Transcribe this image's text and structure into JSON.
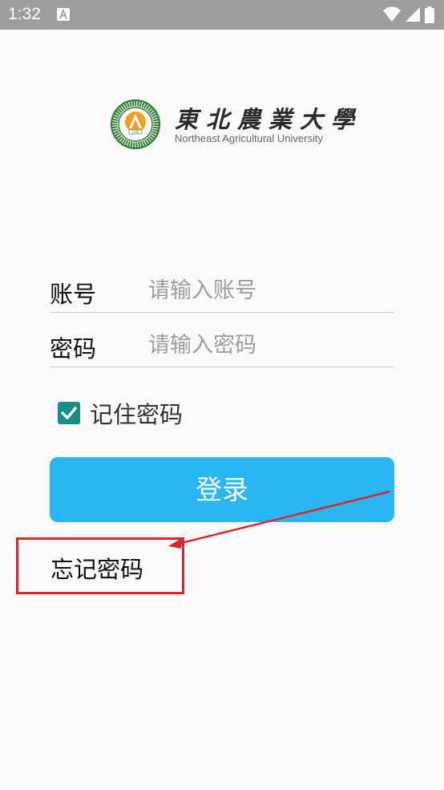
{
  "status_bar": {
    "time": "1:32",
    "notification_icon": "a-notification-icon",
    "icons": [
      "wifi-icon",
      "signal-icon",
      "battery-icon"
    ]
  },
  "logo": {
    "name_cn": "東北農業大學",
    "name_en": "Northeast Agricultural University",
    "seal_text": "NORTHEAST AGRICULTURAL UNIVERSITY",
    "seal_year": "1948",
    "seal_color": "#2e7d32",
    "seal_accent": "#f0a020"
  },
  "form": {
    "account": {
      "label": "账号",
      "placeholder": "请输入账号",
      "value": ""
    },
    "password": {
      "label": "密码",
      "placeholder": "请输入密码",
      "value": ""
    },
    "remember": {
      "label": "记住密码",
      "checked": true,
      "color": "#138f87"
    },
    "login_label": "登录",
    "login_color": "#29b6f2",
    "forgot_label": "忘记密码"
  },
  "annotation": {
    "color": "#d9262f"
  }
}
